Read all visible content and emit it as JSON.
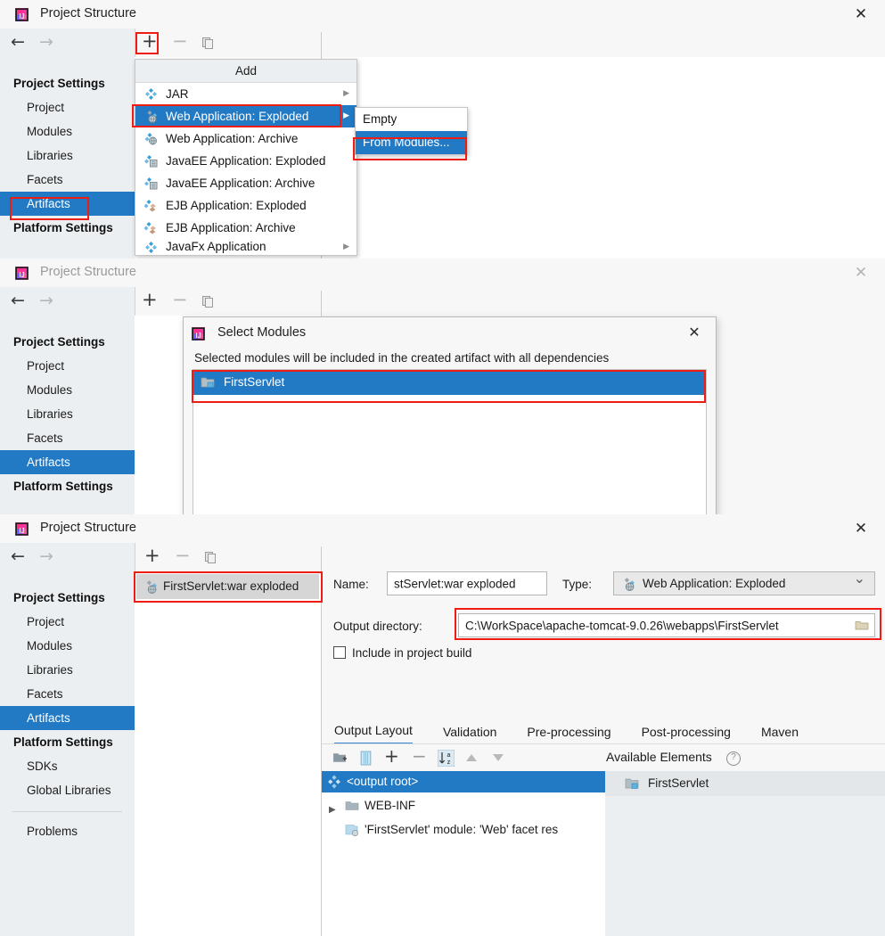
{
  "app": {
    "window_title": "Project Structure",
    "close_label": "✕",
    "icon_name": "intellij-idea-icon"
  },
  "sidebar": {
    "nav_back": "←",
    "nav_forward": "→",
    "groups": [
      {
        "label": "Project Settings",
        "items": [
          "Project",
          "Modules",
          "Libraries",
          "Facets",
          "Artifacts"
        ]
      },
      {
        "label": "Platform Settings",
        "items": [
          "SDKs",
          "Global Libraries"
        ]
      }
    ],
    "selected": "Artifacts",
    "problems": "Problems"
  },
  "toolbar": {
    "add": "+",
    "remove": "−",
    "copy_name": "copy-icon"
  },
  "panel1": {
    "add_menu": {
      "header": "Add",
      "items": [
        {
          "label": "JAR",
          "icon": "jar-icon",
          "submenu": true,
          "selected": false
        },
        {
          "label": "Web Application: Exploded",
          "icon": "web-exploded-icon",
          "submenu": true,
          "selected": true
        },
        {
          "label": "Web Application: Archive",
          "icon": "web-archive-icon",
          "submenu": false,
          "selected": false
        },
        {
          "label": "JavaEE Application: Exploded",
          "icon": "javaee-exploded-icon",
          "submenu": false,
          "selected": false
        },
        {
          "label": "JavaEE Application: Archive",
          "icon": "javaee-archive-icon",
          "submenu": false,
          "selected": false
        },
        {
          "label": "EJB Application: Exploded",
          "icon": "ejb-exploded-icon",
          "submenu": false,
          "selected": false
        },
        {
          "label": "EJB Application: Archive",
          "icon": "ejb-archive-icon",
          "submenu": false,
          "selected": false
        },
        {
          "label": "JavaFx Application",
          "icon": "javafx-icon",
          "submenu": true,
          "selected": false
        }
      ]
    },
    "sub_menu": {
      "items": [
        {
          "label": "Empty",
          "selected": false
        },
        {
          "label": "From Modules...",
          "selected": true
        }
      ]
    }
  },
  "panel2": {
    "dialog": {
      "title": "Select Modules",
      "icon": "intellij-idea-icon",
      "close_label": "✕",
      "description": "Selected modules will be included in the created artifact with all dependencies",
      "modules": [
        {
          "label": "FirstServlet",
          "icon": "module-folder-icon",
          "selected": true
        }
      ]
    }
  },
  "panel3": {
    "artifact_list": [
      {
        "label": "FirstServlet:war exploded",
        "icon": "web-exploded-icon",
        "selected": true
      }
    ],
    "name_label": "Name:",
    "name_value": "stServlet:war exploded",
    "type_label": "Type:",
    "type_value": "Web Application: Exploded",
    "type_icon": "web-exploded-icon",
    "type_chevron": "⌄",
    "output_dir_label": "Output directory:",
    "output_dir_value": "C:\\WorkSpace\\apache-tomcat-9.0.26\\webapps\\FirstServlet",
    "browse_icon": "folder-browse-icon",
    "include_in_build_label": "Include in project build",
    "include_in_build_checked": false,
    "tabs": [
      {
        "label": "Output Layout",
        "active": true
      },
      {
        "label": "Validation",
        "active": false
      },
      {
        "label": "Pre-processing",
        "active": false
      },
      {
        "label": "Post-processing",
        "active": false
      },
      {
        "label": "Maven",
        "active": false
      }
    ],
    "layout_toolbar": [
      "add-directory-icon",
      "add-archive-icon",
      "add-copy-icon",
      "remove-icon",
      "sort-alpha-icon",
      "move-up-icon",
      "move-down-icon"
    ],
    "tree": [
      {
        "label": "<output root>",
        "icon": "output-root-icon",
        "selected": true,
        "indent": 0,
        "expander": false
      },
      {
        "label": "WEB-INF",
        "icon": "folder-icon",
        "selected": false,
        "indent": 1,
        "expander": true
      },
      {
        "label": "'FirstServlet' module: 'Web' facet res",
        "icon": "facet-resource-icon",
        "selected": false,
        "indent": 1,
        "expander": false
      }
    ],
    "available_header": "Available Elements",
    "available_help": "?",
    "available_items": [
      {
        "label": "FirstServlet",
        "icon": "module-folder-icon"
      }
    ]
  },
  "colors": {
    "selection_blue": "#2279c4",
    "annotation_red": "#ee1c12",
    "panel_bg": "#f7f7f7",
    "nav_bg": "#eceff1",
    "tab_underline": "#3d8ad4"
  }
}
